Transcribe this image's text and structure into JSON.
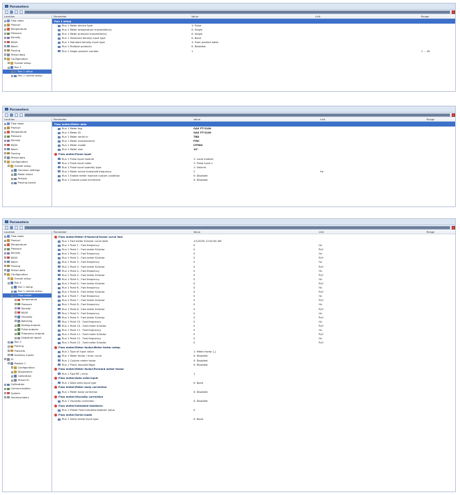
{
  "windows": [
    {
      "title": "Parameters",
      "headers": {
        "location": "Location",
        "parameter": "Parameter",
        "value": "Value",
        "unit": "Unit",
        "range": "Range"
      },
      "tree": [
        {
          "label": "Flow rates",
          "level": 0,
          "icon": "#6b8fd1"
        },
        {
          "label": "Product",
          "level": 0,
          "icon": "#c58b3c"
        },
        {
          "label": "Temperature",
          "level": 0,
          "icon": "#d65a3a"
        },
        {
          "label": "Pressure",
          "level": 0,
          "icon": "#5a8a4a"
        },
        {
          "label": "Density",
          "level": 0,
          "icon": "#8a6ab8"
        },
        {
          "label": "BS/W",
          "level": 0,
          "icon": "#c24a4a"
        },
        {
          "label": "Batch",
          "level": 0,
          "icon": "#5b7fb6"
        },
        {
          "label": "Proving",
          "level": 0,
          "icon": "#a9843a"
        },
        {
          "label": "Period data",
          "level": 0,
          "icon": "#7f8c9d"
        },
        {
          "label": "Configuration",
          "level": 0,
          "icon": "#c9a03a"
        },
        {
          "label": "Overall setup",
          "level": 1,
          "icon": "#c9a03a"
        },
        {
          "label": "Run 1",
          "level": 1,
          "icon": "#5b7fb6"
        },
        {
          "label": "Run 1 setup",
          "level": 2,
          "icon": "#5b7fb6",
          "selected": true
        },
        {
          "label": "Run 1 control setup",
          "level": 2,
          "icon": "#5b7fb6"
        }
      ],
      "sections": [
        {
          "label": "Run 1 setup",
          "band": true,
          "rows": [
            {
              "name": "Run 1 Meter device type",
              "value": "1: Pulse",
              "unit": "",
              "range": ""
            },
            {
              "name": "Run 1 Meter temperature transmitter(s)",
              "value": "0: Single",
              "unit": "",
              "range": ""
            },
            {
              "name": "Run 1 Meter pressure transmitter(s)",
              "value": "0: Single",
              "unit": "",
              "range": ""
            },
            {
              "name": "Run 1 Observed density input type",
              "value": "0: None",
              "unit": "",
              "range": ""
            },
            {
              "name": "Run 1 Standard density input type",
              "value": "1: From product table",
              "unit": "",
              "range": ""
            },
            {
              "name": "Run 1 Multiple products",
              "value": "0: Disabled",
              "unit": "",
              "range": ""
            },
            {
              "name": "Run 1 Single product number",
              "value": "1",
              "unit": "",
              "range": "1 ... 16"
            }
          ]
        }
      ]
    },
    {
      "title": "Parameters",
      "headers": {
        "location": "Location",
        "parameter": "Parameter",
        "value": "Value",
        "unit": "Unit",
        "range": "Range"
      },
      "tree": [
        {
          "label": "Flow rates",
          "level": 0,
          "icon": "#6b8fd1"
        },
        {
          "label": "Product",
          "level": 0,
          "icon": "#c58b3c"
        },
        {
          "label": "Temperature",
          "level": 0,
          "icon": "#d65a3a"
        },
        {
          "label": "Pressure",
          "level": 0,
          "icon": "#5a8a4a"
        },
        {
          "label": "Density",
          "level": 0,
          "icon": "#8a6ab8"
        },
        {
          "label": "BS/W",
          "level": 0,
          "icon": "#c24a4a"
        },
        {
          "label": "Batch",
          "level": 0,
          "icon": "#5b7fb6"
        },
        {
          "label": "Proving",
          "level": 0,
          "icon": "#a9843a"
        },
        {
          "label": "Period data",
          "level": 0,
          "icon": "#7f8c9d"
        },
        {
          "label": "Configuration",
          "level": 0,
          "icon": "#c9a03a"
        },
        {
          "label": "Overall setup",
          "level": 1,
          "icon": "#c9a03a"
        },
        {
          "label": "Common settings",
          "level": 2,
          "icon": "#5b7fb6"
        },
        {
          "label": "Meter ticket",
          "level": 2,
          "icon": "#7f8c9d"
        },
        {
          "label": "Periods",
          "level": 2,
          "icon": "#7f8c9d"
        },
        {
          "label": "Proving Levels",
          "level": 2,
          "icon": "#5b7fb6"
        }
      ],
      "sections": [
        {
          "label": "Flow meter\\Meter data",
          "band": true,
          "rows": [
            {
              "name": "Run 1 Meter tag",
              "value": "GAS FT-3100",
              "unit": "",
              "range": "",
              "bold": true
            },
            {
              "name": "Run 1 Meter ID",
              "value": "GAS FT-3100",
              "unit": "",
              "range": "",
              "bold": true
            },
            {
              "name": "Run 1 Meter serial nr",
              "value": "TBD",
              "unit": "",
              "range": "",
              "bold": true
            },
            {
              "name": "Run 1 Meter manufacturer",
              "value": "FMC",
              "unit": "",
              "range": "",
              "bold": true
            },
            {
              "name": "Run 1 Meter model",
              "value": "UTMIG",
              "unit": "",
              "range": "",
              "bold": true
            },
            {
              "name": "Run 1 Meter size",
              "value": "10\"",
              "unit": "",
              "range": "",
              "bold": true
            }
          ]
        },
        {
          "label": "Flow meter\\Pulse input",
          "band": false,
          "rows": [
            {
              "name": "Run 1 Pulse input module",
              "value": "1: Local module",
              "unit": "",
              "range": ""
            },
            {
              "name": "Run 1 Pulse input index",
              "value": "1: Pulse input 1",
              "unit": "",
              "range": ""
            },
            {
              "name": "Run 1 Pulse input quantity type",
              "value": "1: Volume",
              "unit": "",
              "range": ""
            },
            {
              "name": "Run 1 Meter active threshold frequency",
              "value": "2",
              "unit": "Hz",
              "range": ""
            },
            {
              "name": "Run 1 Enable meter inactive custom condition",
              "value": "0: Disabled",
              "unit": "",
              "range": ""
            },
            {
              "name": "Run 1 Custom pulse increment",
              "value": "0: Disabled",
              "unit": "",
              "range": ""
            }
          ]
        }
      ]
    },
    {
      "title": "Parameters",
      "headers": {
        "location": "Location",
        "parameter": "Parameter",
        "value": "Value",
        "unit": "Unit",
        "range": "Range"
      },
      "tree": [
        {
          "label": "Flow rates",
          "level": 0,
          "icon": "#6b8fd1"
        },
        {
          "label": "Product",
          "level": 0,
          "icon": "#c58b3c"
        },
        {
          "label": "Temperature",
          "level": 0,
          "icon": "#d65a3a"
        },
        {
          "label": "Pressure",
          "level": 0,
          "icon": "#5a8a4a"
        },
        {
          "label": "Density",
          "level": 0,
          "icon": "#8a6ab8"
        },
        {
          "label": "BS/W",
          "level": 0,
          "icon": "#c24a4a"
        },
        {
          "label": "Batch",
          "level": 0,
          "icon": "#5b7fb6"
        },
        {
          "label": "Proving",
          "level": 0,
          "icon": "#a9843a"
        },
        {
          "label": "Period data",
          "level": 0,
          "icon": "#7f8c9d"
        },
        {
          "label": "Configuration",
          "level": 0,
          "icon": "#c9a03a"
        },
        {
          "label": "Overall setup",
          "level": 1,
          "icon": "#c9a03a"
        },
        {
          "label": "Run 1",
          "level": 1,
          "icon": "#5b7fb6"
        },
        {
          "label": "Run 1 setup",
          "level": 2,
          "icon": "#5b7fb6"
        },
        {
          "label": "Run 1 control setup",
          "level": 2,
          "icon": "#5b7fb6"
        },
        {
          "label": "Flow meter",
          "level": 2,
          "icon": "#5b7fb6",
          "selected": true
        },
        {
          "label": "Temperature",
          "level": 3,
          "icon": "#d65a3a"
        },
        {
          "label": "Pressure",
          "level": 3,
          "icon": "#5a8a4a"
        },
        {
          "label": "Density",
          "level": 3,
          "icon": "#8a6ab8"
        },
        {
          "label": "BS/W",
          "level": 3,
          "icon": "#c24a4a"
        },
        {
          "label": "Viscosity",
          "level": 3,
          "icon": "#5b7fb6"
        },
        {
          "label": "Batching",
          "level": 3,
          "icon": "#7f8c9d"
        },
        {
          "label": "Analog outputs",
          "level": 3,
          "icon": "#5a8a4a"
        },
        {
          "label": "Pulse outputs",
          "level": 3,
          "icon": "#5a8a4a"
        },
        {
          "label": "Frequency outputs",
          "level": 3,
          "icon": "#5a8a4a"
        },
        {
          "label": "Snapshot report",
          "level": 3,
          "icon": "#7f8c9d"
        },
        {
          "label": "Run 2",
          "level": 1,
          "icon": "#5b7fb6"
        },
        {
          "label": "Proving",
          "level": 1,
          "icon": "#a9843a"
        },
        {
          "label": "Products",
          "level": 1,
          "icon": "#c58b3c"
        },
        {
          "label": "Auxiliary inputs",
          "level": 1,
          "icon": "#7f8c9d"
        },
        {
          "label": "IO",
          "level": 0,
          "icon": "#7f8c9d"
        },
        {
          "label": "Module 1",
          "level": 1,
          "icon": "#7f8c9d"
        },
        {
          "label": "Configuration",
          "level": 2,
          "icon": "#c9a03a"
        },
        {
          "label": "Diagnostics",
          "level": 2,
          "icon": "#c9a03a"
        },
        {
          "label": "Calibration",
          "level": 2,
          "icon": "#5b7fb6"
        },
        {
          "label": "Period IO",
          "level": 2,
          "icon": "#7f8c9d"
        },
        {
          "label": "Calibration",
          "level": 0,
          "icon": "#5b7fb6"
        },
        {
          "label": "Communication",
          "level": 0,
          "icon": "#5a8a4a"
        },
        {
          "label": "System",
          "level": 0,
          "icon": "#c24a4a"
        },
        {
          "label": "Serialnumbers",
          "level": 0,
          "icon": "#7f8c9d"
        }
      ],
      "sections": [
        {
          "label": "Flow meter\\Meter K-factor\\K-factor curve fwd",
          "band": false,
          "icon": true,
          "rows": [
            {
              "name": "Run 1 Fwd meter K-factor curve date",
              "value": "1/1/2005 12:00:00 AM",
              "unit": "",
              "range": ""
            },
            {
              "name": "Run 1 Point 1 - Fwd frequency",
              "value": "0",
              "unit": "Hz",
              "range": ""
            },
            {
              "name": "Run 1 Point 1 - Fwd meter K-factor",
              "value": "0",
              "unit": "P/cf",
              "range": ""
            },
            {
              "name": "Run 1 Point 2 - Fwd frequency",
              "value": "0",
              "unit": "Hz",
              "range": ""
            },
            {
              "name": "Run 1 Point 2 - Fwd meter K-factor",
              "value": "0",
              "unit": "P/cf",
              "range": ""
            },
            {
              "name": "Run 1 Point 3 - Fwd frequency",
              "value": "0",
              "unit": "Hz",
              "range": ""
            },
            {
              "name": "Run 1 Point 3 - Fwd meter K-factor",
              "value": "0",
              "unit": "P/cf",
              "range": ""
            },
            {
              "name": "Run 1 Point 4 - Fwd frequency",
              "value": "0",
              "unit": "Hz",
              "range": ""
            },
            {
              "name": "Run 1 Point 4 - Fwd meter K-factor",
              "value": "0",
              "unit": "P/cf",
              "range": ""
            },
            {
              "name": "Run 1 Point 5 - Fwd frequency",
              "value": "0",
              "unit": "Hz",
              "range": ""
            },
            {
              "name": "Run 1 Point 5 - Fwd meter K-factor",
              "value": "0",
              "unit": "P/cf",
              "range": ""
            },
            {
              "name": "Run 1 Point 6 - Fwd frequency",
              "value": "0",
              "unit": "Hz",
              "range": ""
            },
            {
              "name": "Run 1 Point 6 - Fwd meter K-factor",
              "value": "0",
              "unit": "P/cf",
              "range": ""
            },
            {
              "name": "Run 1 Point 7 - Fwd frequency",
              "value": "0",
              "unit": "Hz",
              "range": ""
            },
            {
              "name": "Run 1 Point 7 - Fwd meter K-factor",
              "value": "0",
              "unit": "P/cf",
              "range": ""
            },
            {
              "name": "Run 1 Point 8 - Fwd frequency",
              "value": "0",
              "unit": "Hz",
              "range": ""
            },
            {
              "name": "Run 1 Point 8 - Fwd meter K-factor",
              "value": "0",
              "unit": "P/cf",
              "range": ""
            },
            {
              "name": "Run 1 Point 9 - Fwd frequency",
              "value": "0",
              "unit": "Hz",
              "range": ""
            },
            {
              "name": "Run 1 Point 9 - Fwd meter K-factor",
              "value": "0",
              "unit": "P/cf",
              "range": ""
            },
            {
              "name": "Run 1 Point 10 - Fwd frequency",
              "value": "0",
              "unit": "Hz",
              "range": ""
            },
            {
              "name": "Run 1 Point 10 - Fwd meter K-factor",
              "value": "0",
              "unit": "P/cf",
              "range": ""
            },
            {
              "name": "Run 1 Point 11 - Fwd frequency",
              "value": "0",
              "unit": "Hz",
              "range": ""
            },
            {
              "name": "Run 1 Point 11 - Fwd meter K-factor",
              "value": "0",
              "unit": "P/cf",
              "range": ""
            },
            {
              "name": "Run 1 Point 12 - Fwd frequency",
              "value": "0",
              "unit": "Hz",
              "range": ""
            },
            {
              "name": "Run 1 Point 12 - Fwd meter K-factor",
              "value": "0",
              "unit": "P/cf",
              "range": ""
            }
          ]
        },
        {
          "label": "Flow meter\\Meter factor\\Meter factor setup",
          "band": false,
          "rows": [
            {
              "name": "Run 1 Type of input value",
              "value": "1: Meter factor [-]",
              "unit": "",
              "range": ""
            },
            {
              "name": "Run 1 Meter factor / error curve",
              "value": "0: Disabled",
              "unit": "",
              "range": ""
            },
            {
              "name": "Run 1 Custom meter factor",
              "value": "0: Disabled",
              "unit": "",
              "range": ""
            },
            {
              "name": "Run 1 Prove required flags",
              "value": "0: Disabled",
              "unit": "",
              "range": ""
            }
          ]
        },
        {
          "label": "Flow meter\\Meter factor\\Forward meter factor",
          "band": false,
          "rows": [
            {
              "name": "Run 1 Fwd MF / error",
              "value": "1",
              "unit": "",
              "range": ""
            }
          ]
        },
        {
          "label": "Flow meter\\Auto valid input",
          "band": false,
          "rows": [
            {
              "name": "Run 1 Data valid input type",
              "value": "0: None",
              "unit": "",
              "range": ""
            }
          ]
        },
        {
          "label": "Flow meter\\Meter body correction",
          "band": false,
          "rows": [
            {
              "name": "Run 1 Meter body correction",
              "value": "0: Disabled",
              "unit": "",
              "range": ""
            }
          ]
        },
        {
          "label": "Flow meter\\Viscosity correction",
          "band": false,
          "rows": [
            {
              "name": "Run 1 Viscosity correction",
              "value": "0: Disabled",
              "unit": "",
              "range": ""
            }
          ]
        },
        {
          "label": "Flow meter\\Indicated totalizers",
          "band": false,
          "rows": [
            {
              "name": "Run 1 Preset Fwd indicated totalizer value",
              "value": "0",
              "unit": "",
              "range": ""
            }
          ]
        },
        {
          "label": "Flow meter\\Serial mode",
          "band": false,
          "rows": [
            {
              "name": "Run 1 Serial mode input type",
              "value": "0: None",
              "unit": "",
              "range": ""
            }
          ]
        }
      ]
    }
  ]
}
